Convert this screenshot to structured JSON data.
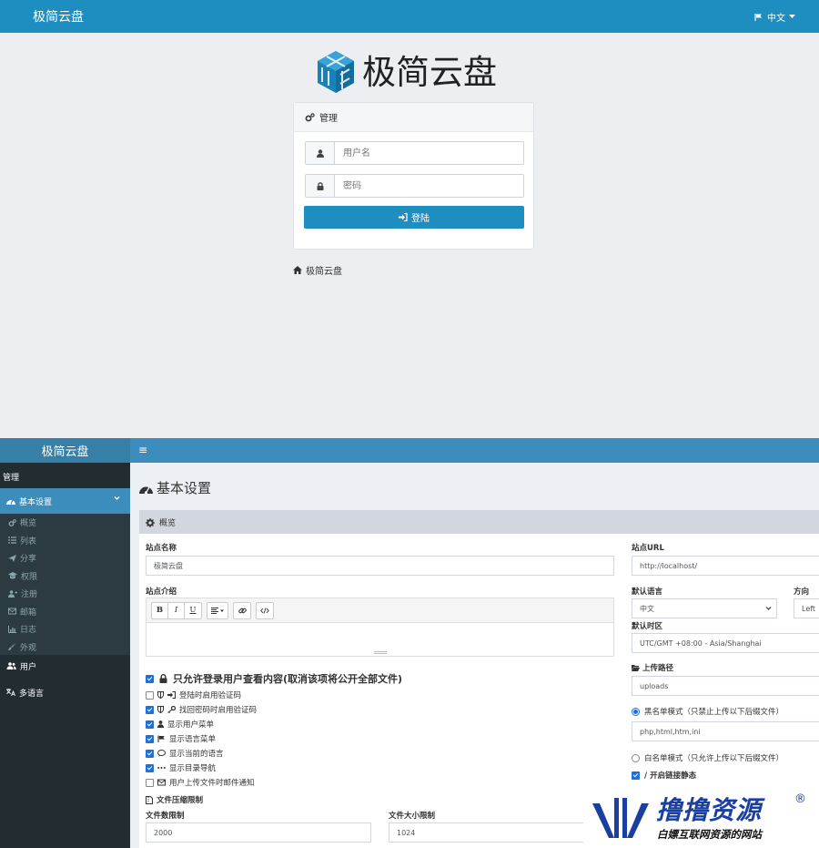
{
  "login": {
    "app_title": "极简云盘",
    "language": "中文",
    "logo_text": "极简云盘",
    "panel_title": "管理",
    "username_placeholder": "用户名",
    "password_placeholder": "密码",
    "login_button": "登陆",
    "home_link": "极简云盘",
    "colors": {
      "header": "#1e8dbf",
      "button": "#1e8dbf",
      "logo": "#1b82b6"
    }
  },
  "admin": {
    "brand": "极简云盘",
    "menu_toggle": "≡",
    "sidebar": {
      "header": "管理",
      "active_item": "基本设置",
      "subitems": [
        {
          "label": "概览",
          "icon": "cogs-icon"
        },
        {
          "label": "列表",
          "icon": "list-icon"
        },
        {
          "label": "分享",
          "icon": "send-icon"
        },
        {
          "label": "权限",
          "icon": "graduation-cap-icon"
        },
        {
          "label": "注册",
          "icon": "user-plus-icon"
        },
        {
          "label": "邮箱",
          "icon": "envelope-icon"
        },
        {
          "label": "日志",
          "icon": "bar-chart-icon"
        },
        {
          "label": "外观",
          "icon": "paint-brush-icon"
        }
      ],
      "items": [
        {
          "label": "用户",
          "icon": "users-icon"
        },
        {
          "label": "多语言",
          "icon": "language-icon"
        }
      ]
    },
    "page_title": "基本设置",
    "box_title": "概览",
    "site_name_label": "站点名称",
    "site_name_value": "极简云盘",
    "site_intro_label": "站点介绍",
    "editor_toolbar": [
      "B",
      "I",
      "U"
    ],
    "main_checkbox": {
      "label": "只允许登录用户查看内容(取消该项将公开全部文件)",
      "checked": true
    },
    "checkboxes": [
      {
        "label": "登陆时启用验证码",
        "checked": false,
        "icon": "sign-in-icon"
      },
      {
        "label": "找回密码时启用验证码",
        "checked": true,
        "icon": "key-icon"
      },
      {
        "label": "显示用户菜单",
        "checked": true,
        "icon": "user-icon"
      },
      {
        "label": "显示语言菜单",
        "checked": true,
        "icon": "flag-icon"
      },
      {
        "label": "显示当前的语言",
        "checked": true,
        "icon": "comment-icon"
      },
      {
        "label": "显示目录导航",
        "checked": true,
        "icon": "ellipsis-icon"
      },
      {
        "label": "用户上传文件时邮件通知",
        "checked": false,
        "icon": "envelope-icon"
      }
    ],
    "compress_heading": "文件压缩限制",
    "file_count_label": "文件数限制",
    "file_count_value": "2000",
    "file_size_label": "文件大小限制",
    "file_size_value": "1024",
    "site_url_label": "站点URL",
    "site_url_value": "http://localhost/",
    "default_lang_label": "默认语言",
    "default_lang_value": "中文",
    "direction_label": "方向",
    "direction_value": "Left",
    "timezone_label": "默认时区",
    "timezone_value": "UTC/GMT +08:00 - Asia/Shanghai",
    "upload_path_label": "上传路径",
    "upload_path_value": "uploads",
    "blacklist_label": "黑名单模式（只禁止上传以下后缀文件）",
    "blacklist_selected": true,
    "blacklist_value": "php,html,htm,ini",
    "whitelist_label": "白名单模式（只允许上传以下后缀文件）",
    "static_links_label": "/ 开启链接静态",
    "static_links_checked": true,
    "colors": {
      "sidebar": "#222d32",
      "sidebar_active": "#3c8dbc",
      "topnav": "#3c8dbc",
      "brand_bar": "#367fa9"
    }
  },
  "watermark": {
    "title": "撸撸资源",
    "registered": "®",
    "subtitle": "白嫖互联网资源的网站"
  }
}
